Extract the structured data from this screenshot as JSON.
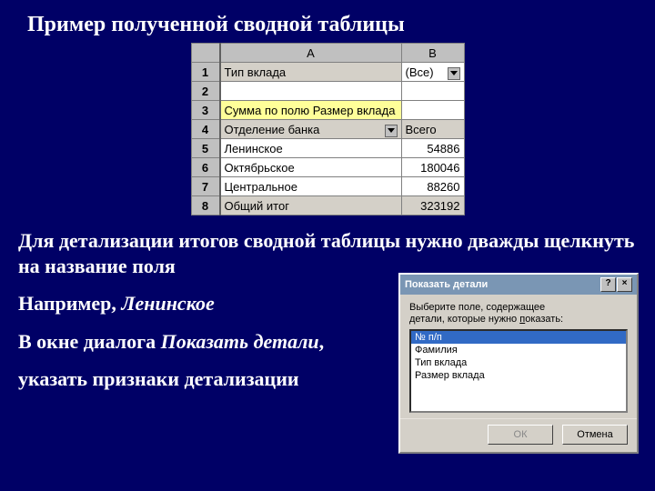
{
  "title": "Пример полученной сводной таблицы",
  "pivot": {
    "col_a": "A",
    "col_b": "B",
    "rows": {
      "1_a": "Тип вклада",
      "1_b": "(Все)",
      "3_a": "Сумма по полю Размер вклада",
      "4_a": "Отделение банка",
      "4_b": "Всего",
      "5_a": "Ленинское",
      "5_b": "54886",
      "6_a": "Октябрьское",
      "6_b": "180046",
      "7_a": "Центральное",
      "7_b": "88260",
      "8_a": "Общий итог",
      "8_b": "323192"
    },
    "rownums": [
      "1",
      "2",
      "3",
      "4",
      "5",
      "6",
      "7",
      "8"
    ]
  },
  "text": {
    "line1": "Для детализации итогов сводной таблицы нужно дважды щелкнуть на название поля",
    "line2_a": "Например, ",
    "line2_b": "Ленинское",
    "line3_a": "В окне диалога ",
    "line3_b": "Показать детали",
    "line3_c": ",",
    "line4": "указать признаки детализации"
  },
  "dialog": {
    "title": "Показать детали",
    "help": "?",
    "close": "×",
    "label": "Выберите поле, содержащее детали, которые нужно показать:",
    "items": [
      "№ п/п",
      "Фамилия",
      "Тип вклада",
      "Размер вклада"
    ],
    "ok": "ОК",
    "cancel": "Отмена"
  }
}
